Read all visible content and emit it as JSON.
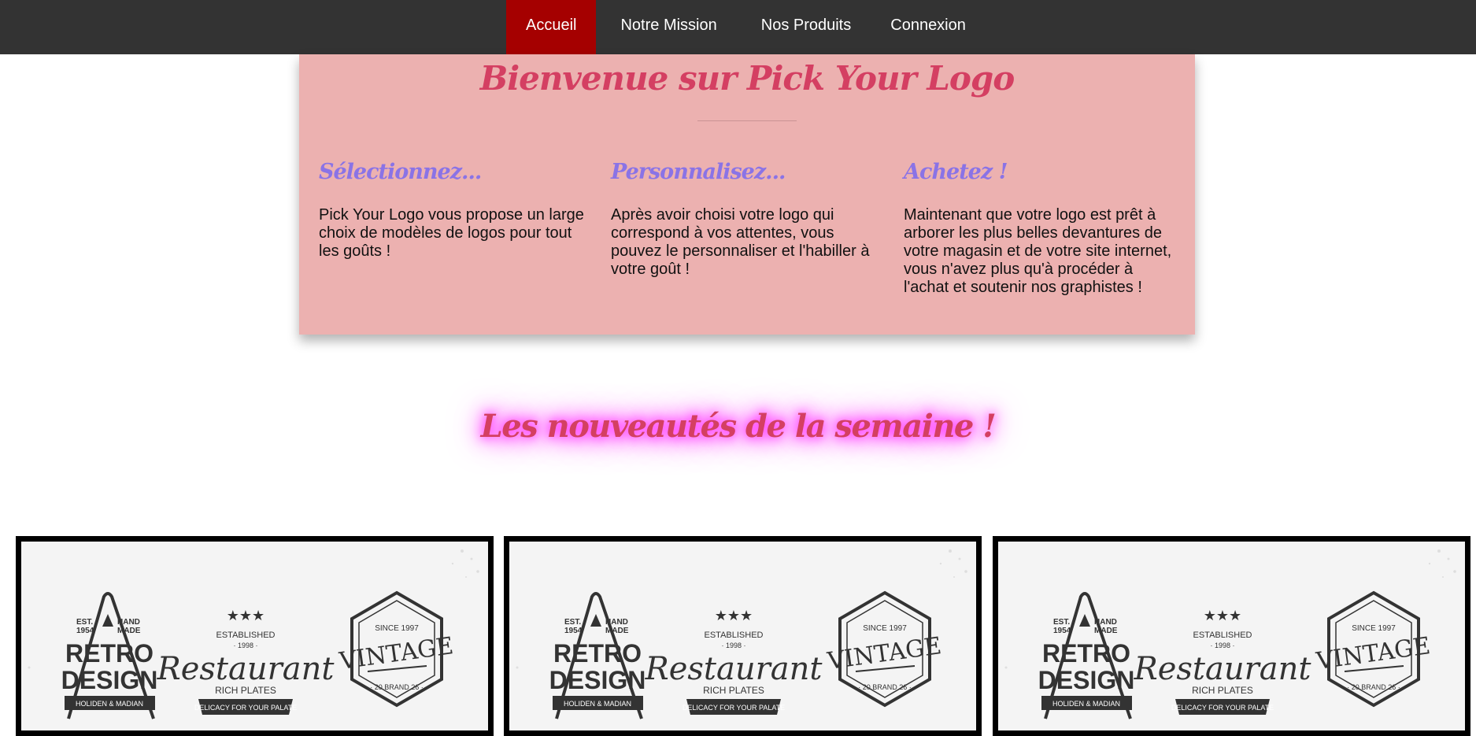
{
  "nav": {
    "items": [
      {
        "label": "Accueil",
        "active": true
      },
      {
        "label": "Notre Mission",
        "active": false
      },
      {
        "label": "Nos Produits",
        "active": false
      },
      {
        "label": "Connexion",
        "active": false
      }
    ]
  },
  "welcome": {
    "title": "Bienvenue sur Pick Your Logo",
    "columns": [
      {
        "title": "Sélectionnez...",
        "text": "Pick Your Logo vous propose un large choix de modèles de logos pour tout les goûts !"
      },
      {
        "title": "Personnalisez...",
        "text": "Après avoir choisi votre logo qui correspond à vos attentes, vous pouvez le personnaliser et l'habiller à votre goût !"
      },
      {
        "title": "Achetez !",
        "text": "Maintenant que votre logo est prêt à arborer les plus belles devantures de votre magasin et de votre site internet, vous n'avez plus qu'à procéder à l'achat et soutenir nos graphistes !"
      }
    ]
  },
  "weekly": {
    "title": "Les nouveautés de la semaine !"
  },
  "logo_card": {
    "badge1": {
      "est": "EST.",
      "year": "1954",
      "hand": "HAND",
      "made": "MADE",
      "line1": "RETRO",
      "line2": "DESIGN",
      "ribbon": "HOLIDEN & MADIAN"
    },
    "badge2": {
      "established": "ESTABLISHED",
      "year": "· 1998 ·",
      "name": "Restaurant",
      "sub": "RICH PLATES",
      "ribbon": "DELICACY FOR YOUR PALATE"
    },
    "badge3": {
      "since": "SINCE 1997",
      "name": "VINTAGE",
      "sub": "· 20 BRAND 26 ·"
    }
  },
  "colors": {
    "nav_bg": "#333333",
    "nav_active": "#a50000",
    "welcome_bg": "#ecb1b0",
    "title_pink": "#d43f62",
    "column_title_purple": "#8a73e6",
    "glow": "#ff3cff"
  }
}
